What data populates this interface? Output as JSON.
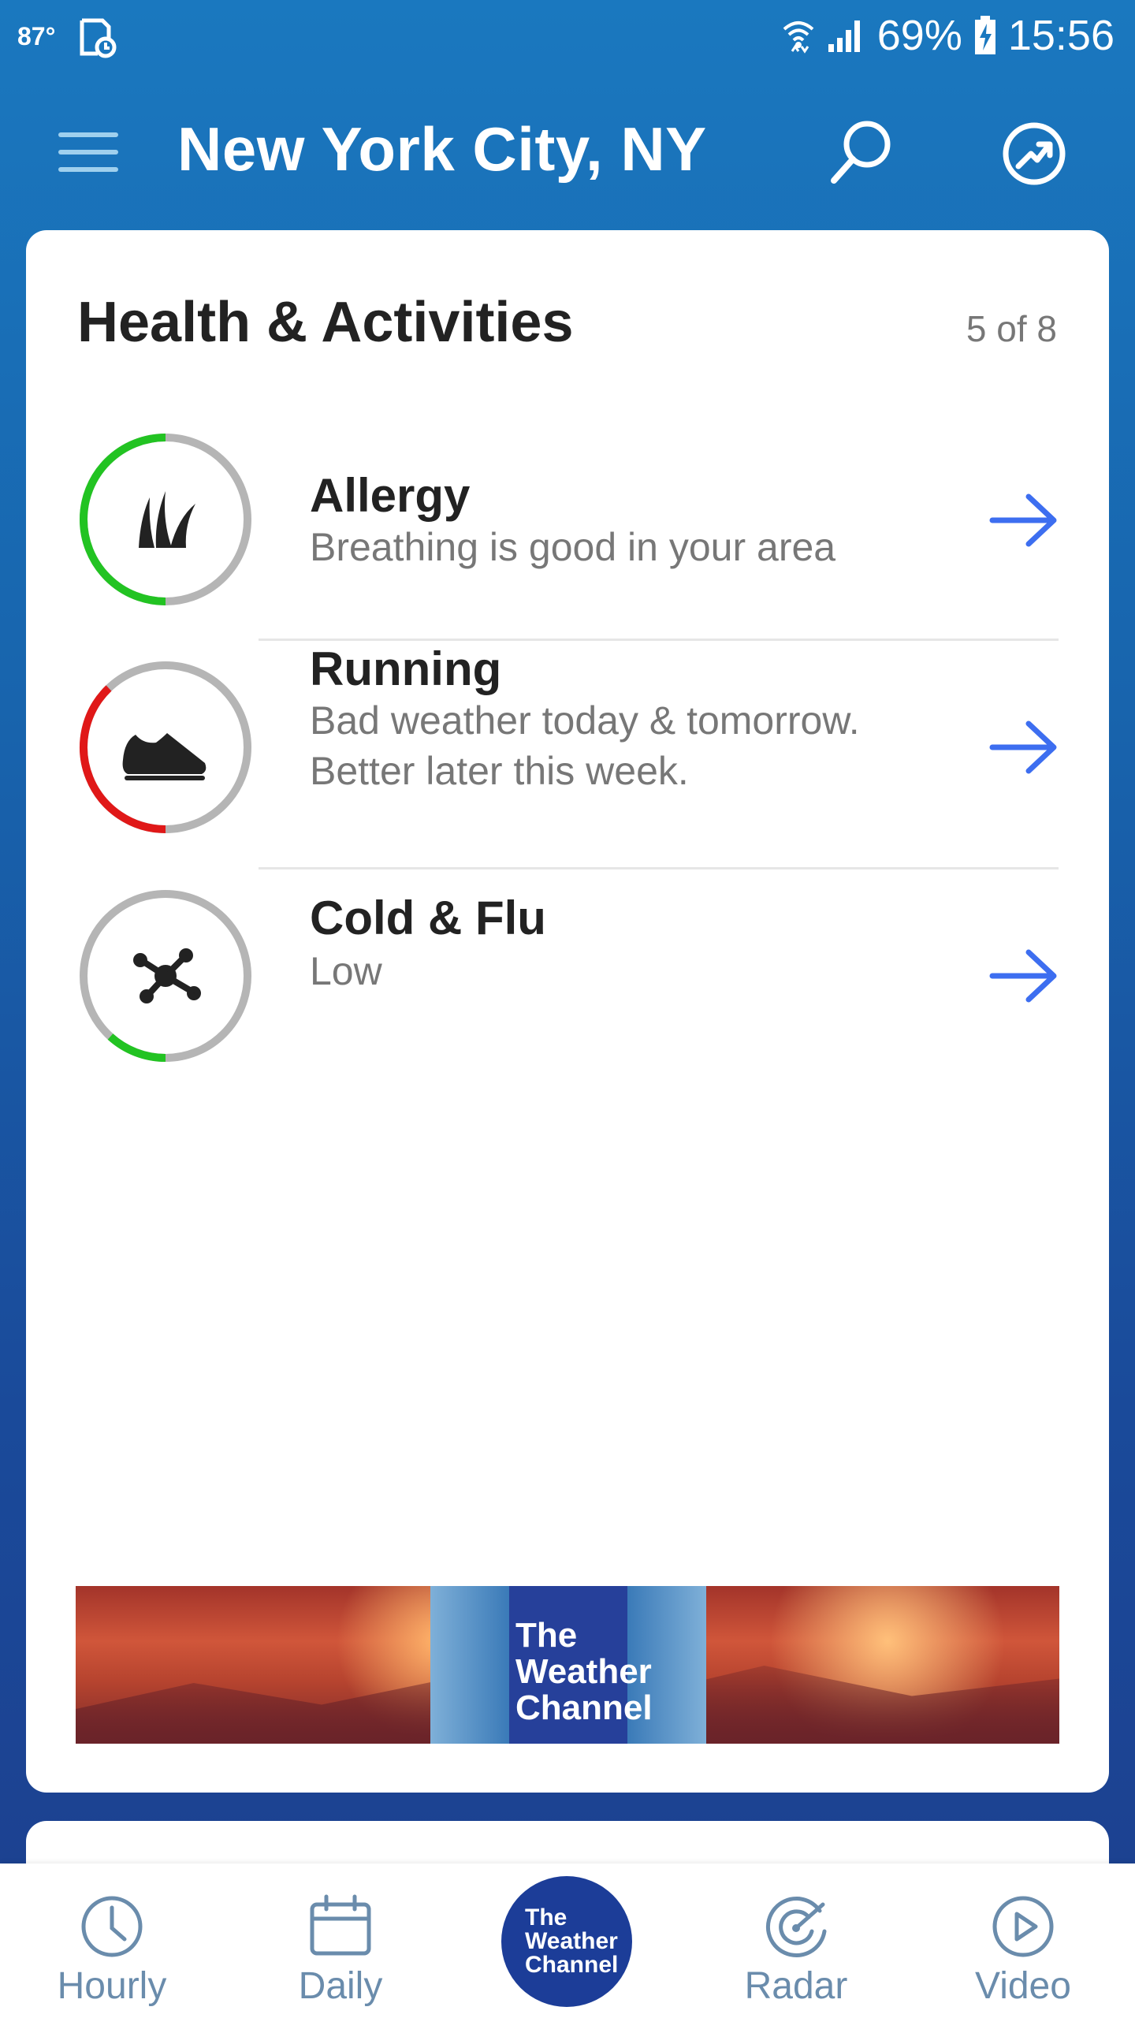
{
  "status_bar": {
    "temperature": "87°",
    "battery": "69%",
    "time": "15:56"
  },
  "app_bar": {
    "location_title": "New York City, NY"
  },
  "card": {
    "title": "Health & Activities",
    "pager": "5 of 8",
    "items": [
      {
        "name": "Allergy",
        "description": "Breathing is good in your area",
        "ring_color": "#22c322",
        "icon": "grass-icon"
      },
      {
        "name": "Running",
        "description": "Bad weather today & tomorrow. Better later this week.",
        "ring_color": "#e01818",
        "icon": "shoe-icon"
      },
      {
        "name": "Cold & Flu",
        "description": "Low",
        "ring_color": "#22c322",
        "icon": "virus-icon"
      }
    ]
  },
  "ad": {
    "logo_line1": "The",
    "logo_line2": "Weather",
    "logo_line3": "Channel"
  },
  "bottom_nav": {
    "items": [
      {
        "label": "Hourly",
        "icon": "clock-icon"
      },
      {
        "label": "Daily",
        "icon": "calendar-icon"
      },
      {
        "label": "The Weather Channel",
        "icon": "twc-logo"
      },
      {
        "label": "Radar",
        "icon": "radar-icon"
      },
      {
        "label": "Video",
        "icon": "play-icon"
      }
    ],
    "twc_line1": "The",
    "twc_line2": "Weather",
    "twc_line3": "Channel"
  },
  "colors": {
    "accent_arrow": "#3d6ef0",
    "ring_gray": "#b5b5b5"
  }
}
